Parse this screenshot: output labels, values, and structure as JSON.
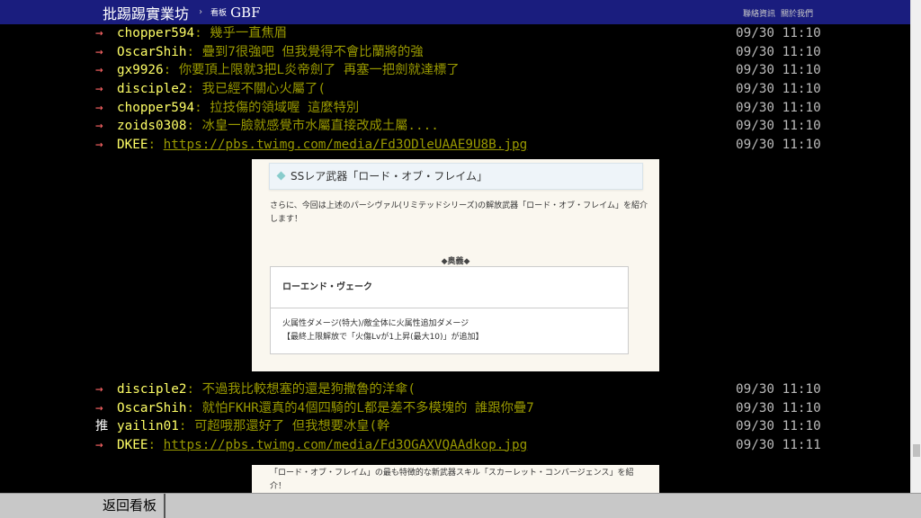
{
  "header": {
    "site_title": "批踢踢實業坊",
    "separator": "›",
    "board_label": "看板",
    "board_name": "GBF",
    "links": [
      "聯絡資訊",
      "關於我們"
    ]
  },
  "pushes_top": [
    {
      "tag": "→",
      "user": "chopper594",
      "text": ": 幾乎一直焦眉",
      "time": "09/30 11:10"
    },
    {
      "tag": "→",
      "user": "OscarShih",
      "text": ": 疊到7很強吧 但我覺得不會比蘭將的強",
      "time": "09/30 11:10"
    },
    {
      "tag": "→",
      "user": "gx9926",
      "text": ": 你要頂上限就3把L炎帝劍了 再塞一把劍就達標了",
      "time": "09/30 11:10"
    },
    {
      "tag": "→",
      "user": "disciple2",
      "text": ": 我已經不關心火屬了(",
      "time": "09/30 11:10"
    },
    {
      "tag": "→",
      "user": "chopper594",
      "text": ": 拉技傷的領域喔  這麼特別",
      "time": "09/30 11:10"
    },
    {
      "tag": "→",
      "user": "zoids0308",
      "text": ": 冰皇一臉就感覺市水屬直接改成土屬....",
      "time": "09/30 11:10"
    },
    {
      "tag": "→",
      "user": "DKEE",
      "text": ": ",
      "link": "https://pbs.twimg.com/media/Fd3ODleUAAE9U8B.jpg",
      "time": "09/30 11:10"
    }
  ],
  "image1": {
    "heading": "SSレア武器「ロード・オブ・フレイム」",
    "intro": "さらに、今回は上述のパーシヴァル(リミテッドシリーズ)の解放武器「ロード・オブ・フレイム」を紹介します！",
    "section": "◆奥義◆",
    "ougi_name": "ローエンド・ヴェーク",
    "ougi_desc1": "火属性ダメージ(特大)/敵全体に火属性追加ダメージ",
    "ougi_desc2": "【最終上限解放で「火傷Lvが1上昇(最大10)」が追加】"
  },
  "pushes_bottom": [
    {
      "tag": "→",
      "user": "disciple2",
      "text": ": 不過我比較想塞的還是狗撒魯的洋傘(",
      "time": "09/30 11:10"
    },
    {
      "tag": "→",
      "user": "OscarShih",
      "text": ": 就怕FKHR還真的4個四騎的L都是差不多模塊的 誰跟你疊7",
      "time": "09/30 11:10"
    },
    {
      "tag": "推",
      "user": "yailin01",
      "text": ": 可超哦那還好了 但我想要冰皇(幹",
      "time": "09/30 11:10"
    },
    {
      "tag": "→",
      "user": "DKEE",
      "text": ": ",
      "link": "https://pbs.twimg.com/media/Fd3OGAXVQAAdkop.jpg",
      "time": "09/30 11:11"
    }
  ],
  "image2": {
    "text": "「ロード・オブ・フレイム」の最も特徴的な新武器スキル「スカーレット・コンバージェンス」を紹介！"
  },
  "footer": {
    "back_label": "返回看板"
  }
}
